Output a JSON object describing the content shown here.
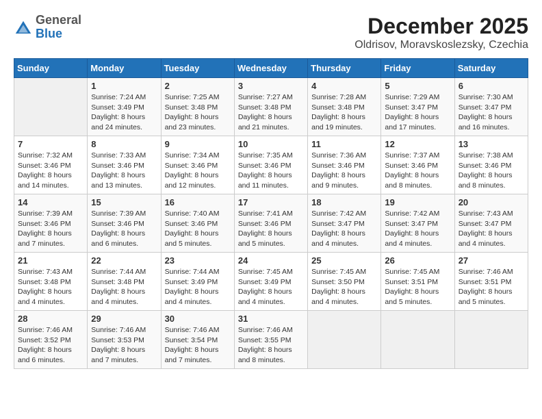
{
  "logo": {
    "general": "General",
    "blue": "Blue"
  },
  "title": "December 2025",
  "location": "Oldrisov, Moravskoslezsky, Czechia",
  "weekdays": [
    "Sunday",
    "Monday",
    "Tuesday",
    "Wednesday",
    "Thursday",
    "Friday",
    "Saturday"
  ],
  "weeks": [
    [
      {
        "day": "",
        "sunrise": "",
        "sunset": "",
        "daylight": ""
      },
      {
        "day": "1",
        "sunrise": "Sunrise: 7:24 AM",
        "sunset": "Sunset: 3:49 PM",
        "daylight": "Daylight: 8 hours and 24 minutes."
      },
      {
        "day": "2",
        "sunrise": "Sunrise: 7:25 AM",
        "sunset": "Sunset: 3:48 PM",
        "daylight": "Daylight: 8 hours and 23 minutes."
      },
      {
        "day": "3",
        "sunrise": "Sunrise: 7:27 AM",
        "sunset": "Sunset: 3:48 PM",
        "daylight": "Daylight: 8 hours and 21 minutes."
      },
      {
        "day": "4",
        "sunrise": "Sunrise: 7:28 AM",
        "sunset": "Sunset: 3:48 PM",
        "daylight": "Daylight: 8 hours and 19 minutes."
      },
      {
        "day": "5",
        "sunrise": "Sunrise: 7:29 AM",
        "sunset": "Sunset: 3:47 PM",
        "daylight": "Daylight: 8 hours and 17 minutes."
      },
      {
        "day": "6",
        "sunrise": "Sunrise: 7:30 AM",
        "sunset": "Sunset: 3:47 PM",
        "daylight": "Daylight: 8 hours and 16 minutes."
      }
    ],
    [
      {
        "day": "7",
        "sunrise": "Sunrise: 7:32 AM",
        "sunset": "Sunset: 3:46 PM",
        "daylight": "Daylight: 8 hours and 14 minutes."
      },
      {
        "day": "8",
        "sunrise": "Sunrise: 7:33 AM",
        "sunset": "Sunset: 3:46 PM",
        "daylight": "Daylight: 8 hours and 13 minutes."
      },
      {
        "day": "9",
        "sunrise": "Sunrise: 7:34 AM",
        "sunset": "Sunset: 3:46 PM",
        "daylight": "Daylight: 8 hours and 12 minutes."
      },
      {
        "day": "10",
        "sunrise": "Sunrise: 7:35 AM",
        "sunset": "Sunset: 3:46 PM",
        "daylight": "Daylight: 8 hours and 11 minutes."
      },
      {
        "day": "11",
        "sunrise": "Sunrise: 7:36 AM",
        "sunset": "Sunset: 3:46 PM",
        "daylight": "Daylight: 8 hours and 9 minutes."
      },
      {
        "day": "12",
        "sunrise": "Sunrise: 7:37 AM",
        "sunset": "Sunset: 3:46 PM",
        "daylight": "Daylight: 8 hours and 8 minutes."
      },
      {
        "day": "13",
        "sunrise": "Sunrise: 7:38 AM",
        "sunset": "Sunset: 3:46 PM",
        "daylight": "Daylight: 8 hours and 8 minutes."
      }
    ],
    [
      {
        "day": "14",
        "sunrise": "Sunrise: 7:39 AM",
        "sunset": "Sunset: 3:46 PM",
        "daylight": "Daylight: 8 hours and 7 minutes."
      },
      {
        "day": "15",
        "sunrise": "Sunrise: 7:39 AM",
        "sunset": "Sunset: 3:46 PM",
        "daylight": "Daylight: 8 hours and 6 minutes."
      },
      {
        "day": "16",
        "sunrise": "Sunrise: 7:40 AM",
        "sunset": "Sunset: 3:46 PM",
        "daylight": "Daylight: 8 hours and 5 minutes."
      },
      {
        "day": "17",
        "sunrise": "Sunrise: 7:41 AM",
        "sunset": "Sunset: 3:46 PM",
        "daylight": "Daylight: 8 hours and 5 minutes."
      },
      {
        "day": "18",
        "sunrise": "Sunrise: 7:42 AM",
        "sunset": "Sunset: 3:47 PM",
        "daylight": "Daylight: 8 hours and 4 minutes."
      },
      {
        "day": "19",
        "sunrise": "Sunrise: 7:42 AM",
        "sunset": "Sunset: 3:47 PM",
        "daylight": "Daylight: 8 hours and 4 minutes."
      },
      {
        "day": "20",
        "sunrise": "Sunrise: 7:43 AM",
        "sunset": "Sunset: 3:47 PM",
        "daylight": "Daylight: 8 hours and 4 minutes."
      }
    ],
    [
      {
        "day": "21",
        "sunrise": "Sunrise: 7:43 AM",
        "sunset": "Sunset: 3:48 PM",
        "daylight": "Daylight: 8 hours and 4 minutes."
      },
      {
        "day": "22",
        "sunrise": "Sunrise: 7:44 AM",
        "sunset": "Sunset: 3:48 PM",
        "daylight": "Daylight: 8 hours and 4 minutes."
      },
      {
        "day": "23",
        "sunrise": "Sunrise: 7:44 AM",
        "sunset": "Sunset: 3:49 PM",
        "daylight": "Daylight: 8 hours and 4 minutes."
      },
      {
        "day": "24",
        "sunrise": "Sunrise: 7:45 AM",
        "sunset": "Sunset: 3:49 PM",
        "daylight": "Daylight: 8 hours and 4 minutes."
      },
      {
        "day": "25",
        "sunrise": "Sunrise: 7:45 AM",
        "sunset": "Sunset: 3:50 PM",
        "daylight": "Daylight: 8 hours and 4 minutes."
      },
      {
        "day": "26",
        "sunrise": "Sunrise: 7:45 AM",
        "sunset": "Sunset: 3:51 PM",
        "daylight": "Daylight: 8 hours and 5 minutes."
      },
      {
        "day": "27",
        "sunrise": "Sunrise: 7:46 AM",
        "sunset": "Sunset: 3:51 PM",
        "daylight": "Daylight: 8 hours and 5 minutes."
      }
    ],
    [
      {
        "day": "28",
        "sunrise": "Sunrise: 7:46 AM",
        "sunset": "Sunset: 3:52 PM",
        "daylight": "Daylight: 8 hours and 6 minutes."
      },
      {
        "day": "29",
        "sunrise": "Sunrise: 7:46 AM",
        "sunset": "Sunset: 3:53 PM",
        "daylight": "Daylight: 8 hours and 7 minutes."
      },
      {
        "day": "30",
        "sunrise": "Sunrise: 7:46 AM",
        "sunset": "Sunset: 3:54 PM",
        "daylight": "Daylight: 8 hours and 7 minutes."
      },
      {
        "day": "31",
        "sunrise": "Sunrise: 7:46 AM",
        "sunset": "Sunset: 3:55 PM",
        "daylight": "Daylight: 8 hours and 8 minutes."
      },
      {
        "day": "",
        "sunrise": "",
        "sunset": "",
        "daylight": ""
      },
      {
        "day": "",
        "sunrise": "",
        "sunset": "",
        "daylight": ""
      },
      {
        "day": "",
        "sunrise": "",
        "sunset": "",
        "daylight": ""
      }
    ]
  ]
}
